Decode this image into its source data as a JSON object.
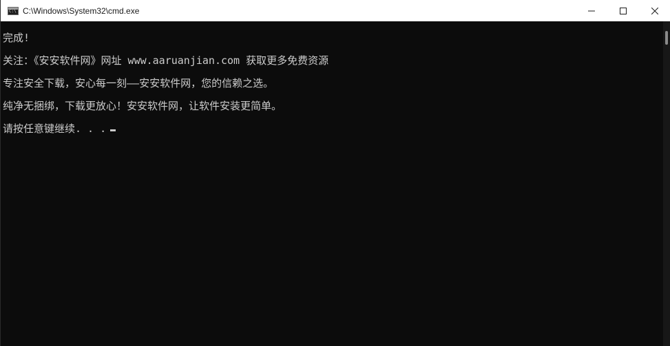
{
  "window": {
    "title": "C:\\Windows\\System32\\cmd.exe",
    "icon": "cmd-console-icon",
    "controls": [
      "minimize-icon",
      "maximize-icon",
      "close-icon"
    ]
  },
  "console": {
    "lines": [
      "完成!",
      "关注：《安安软件网》网址 www.aaruanjian.com 获取更多免费资源",
      "专注安全下载，安心每一刻——安安软件网，您的信赖之选。",
      "纯净无捆绑，下载更放心！安安软件网，让软件安装更简单。",
      "请按任意键继续. . ."
    ]
  },
  "colors": {
    "background": "#0c0c0c",
    "text": "#cccccc",
    "titlebar": "#ffffff"
  }
}
